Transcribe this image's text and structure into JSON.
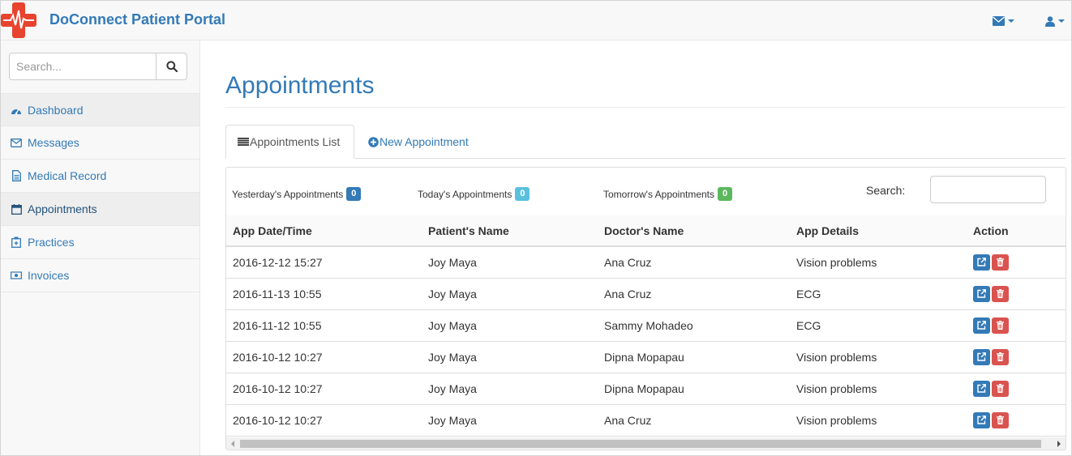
{
  "app": {
    "brand": "DoConnect Patient Portal",
    "colors": {
      "primary": "#337ab7",
      "logo": "#e8432e",
      "info": "#5bc0de",
      "success": "#5cb85c",
      "danger": "#d9534f"
    }
  },
  "navbar": {
    "icons": [
      "envelope-icon",
      "user-icon"
    ]
  },
  "sidebar": {
    "search_placeholder": "Search...",
    "items": [
      {
        "label": "Dashboard",
        "icon": "dashboard-icon"
      },
      {
        "label": "Messages",
        "icon": "envelope-icon"
      },
      {
        "label": "Medical Record",
        "icon": "file-icon"
      },
      {
        "label": "Appointments",
        "icon": "calendar-icon",
        "active": true
      },
      {
        "label": "Practices",
        "icon": "hospital-icon"
      },
      {
        "label": "Invoices",
        "icon": "money-icon"
      }
    ]
  },
  "main": {
    "title": "Appointments",
    "tabs": [
      {
        "label": "Appointments List",
        "icon": "list-icon",
        "active": true
      },
      {
        "label": "New Appointment",
        "icon": "plus-circle-icon"
      }
    ],
    "stats": [
      {
        "label": "Yesterday's Appointments",
        "count": "0",
        "color": "#337ab7"
      },
      {
        "label": "Today's Appointments",
        "count": "0",
        "color": "#5bc0de"
      },
      {
        "label": "Tomorrow's Appointments",
        "count": "0",
        "color": "#5cb85c"
      }
    ],
    "search_label": "Search:",
    "table": {
      "headers": [
        "App Date/Time",
        "Patient's Name",
        "Doctor's Name",
        "App Details",
        "Action"
      ],
      "rows": [
        [
          "2016-12-12 15:27",
          "Joy Maya",
          "Ana Cruz",
          "Vision problems"
        ],
        [
          "2016-11-13 10:55",
          "Joy Maya",
          "Ana Cruz",
          "ECG"
        ],
        [
          "2016-11-12 10:55",
          "Joy Maya",
          "Sammy Mohadeo",
          "ECG"
        ],
        [
          "2016-10-12 10:27",
          "Joy Maya",
          "Dipna Mopapau",
          "Vision problems"
        ],
        [
          "2016-10-12 10:27",
          "Joy Maya",
          "Dipna Mopapau",
          "Vision problems"
        ],
        [
          "2016-10-12 10:27",
          "Joy Maya",
          "Ana Cruz",
          "Vision problems"
        ]
      ]
    }
  }
}
